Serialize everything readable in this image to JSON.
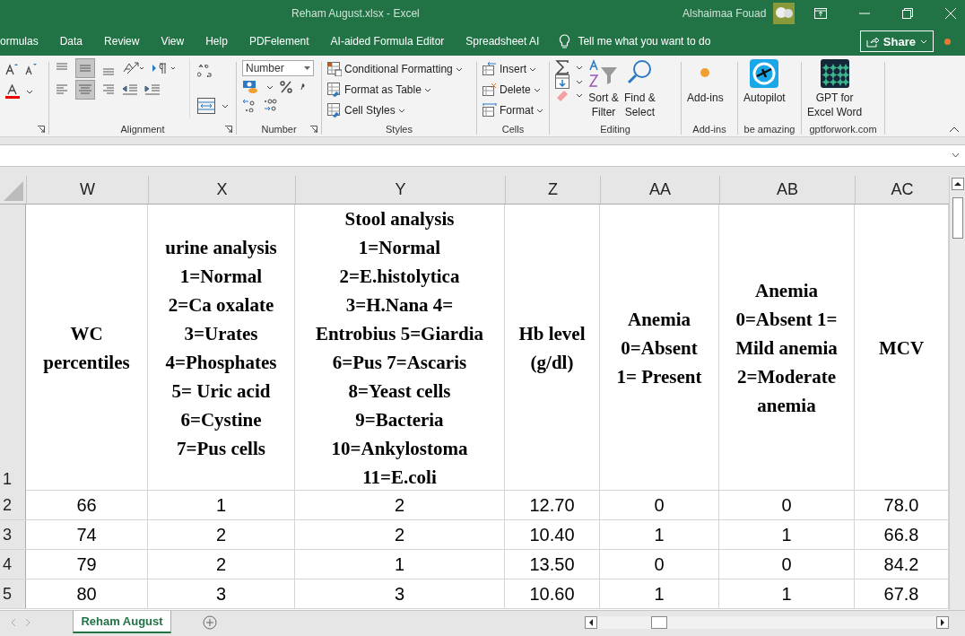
{
  "title_bar": {
    "document_title": "Reham August.xlsx  -  Excel",
    "user": "Alshaimaa Fouad"
  },
  "menu_tabs": [
    "ormulas",
    "Data",
    "Review",
    "View",
    "Help",
    "PDFelement",
    "AI-aided Formula Editor",
    "Spreadsheet AI"
  ],
  "tell_me": {
    "placeholder": "Tell me what you want to do"
  },
  "share_button": "Share",
  "ribbon": {
    "alignment": {
      "label": "Alignment"
    },
    "number": {
      "label": "Number",
      "format": "Number"
    },
    "styles": {
      "label": "Styles",
      "buttons": [
        "Conditional Formatting",
        "Format as Table",
        "Cell Styles"
      ]
    },
    "cells": {
      "label": "Cells",
      "buttons": [
        "Insert",
        "Delete",
        "Format"
      ]
    },
    "editing": {
      "label": "Editing",
      "buttons": [
        "Sort &\nFilter",
        "Find &\nSelect"
      ]
    },
    "addins": {
      "label": "Add-ins",
      "button": "Add-ins"
    },
    "autopilot": {
      "label": "be amazing",
      "button": "Autopilot"
    },
    "gpt": {
      "label": "gptforwork.com",
      "button": "GPT for\nExcel Word"
    }
  },
  "sheet": {
    "columns": [
      "W",
      "X",
      "Y",
      "Z",
      "AA",
      "AB",
      "AC"
    ],
    "header_row": {
      "number": "1",
      "cells": [
        "WC\npercentiles",
        "urine analysis\n1=Normal\n2=Ca oxalate\n3=Urates\n4=Phosphates\n5= Uric acid\n6=Cystine\n7=Pus cells",
        "Stool analysis\n1=Normal\n2=E.histolytica\n3=H.Nana 4=\nEntrobius 5=Giardia\n6=Pus 7=Ascaris\n8=Yeast cells\n9=Bacteria\n10=Ankylostoma\n11=E.coli",
        "Hb level\n(g/dl)",
        "Anemia\n0=Absent\n1= Present",
        "Anemia\n0=Absent 1=\nMild anemia\n2=Moderate\nanemia",
        "MCV"
      ]
    },
    "rows": [
      {
        "number": "2",
        "cells": [
          "66",
          "1",
          "2",
          "12.70",
          "0",
          "0",
          "78.0"
        ]
      },
      {
        "number": "3",
        "cells": [
          "74",
          "2",
          "2",
          "10.40",
          "1",
          "1",
          "66.8"
        ]
      },
      {
        "number": "4",
        "cells": [
          "79",
          "2",
          "1",
          "13.50",
          "0",
          "0",
          "84.2"
        ]
      },
      {
        "number": "5",
        "cells": [
          "80",
          "3",
          "3",
          "10.60",
          "1",
          "1",
          "67.8"
        ]
      }
    ]
  },
  "sheet_tabs": [
    {
      "label": "Reham August",
      "selected": true
    }
  ]
}
